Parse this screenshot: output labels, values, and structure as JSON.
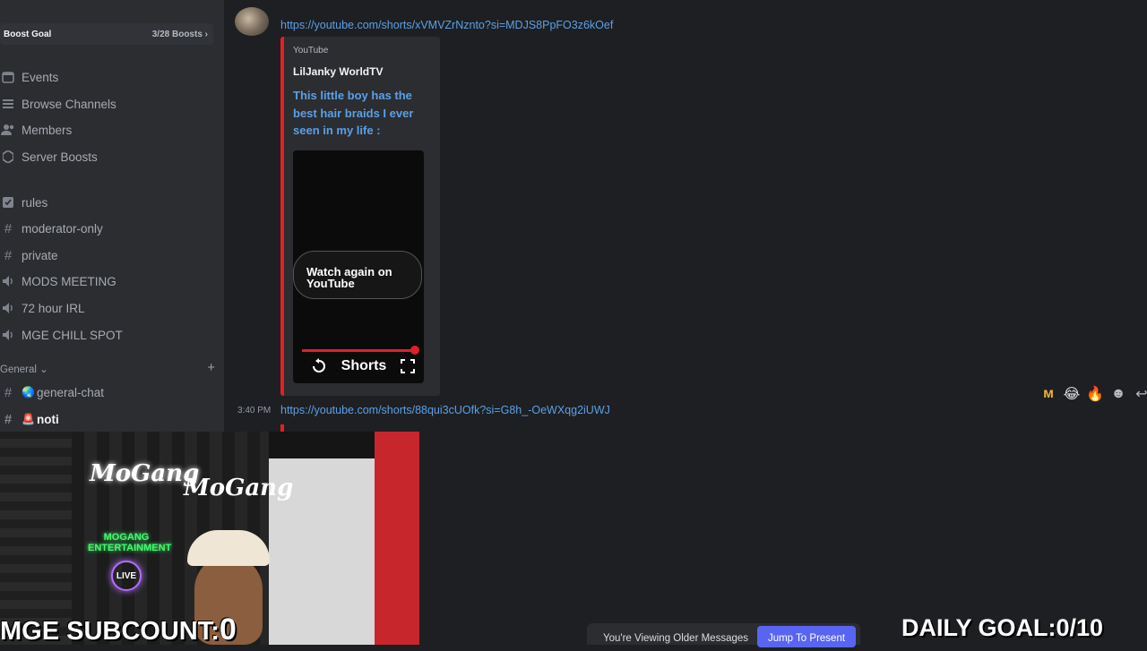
{
  "sidebar": {
    "boost_goal": {
      "label": "Boost Goal",
      "count": "3/28 Boosts"
    },
    "items": [
      {
        "label": "Events",
        "icon": "calendar-icon"
      },
      {
        "label": "Browse Channels",
        "icon": "list-icon"
      },
      {
        "label": "Members",
        "icon": "members-icon"
      },
      {
        "label": "Server Boosts",
        "icon": "boost-icon"
      },
      {
        "label": "rules",
        "icon": "rules-icon"
      },
      {
        "label": "moderator-only",
        "icon": "hash-icon"
      },
      {
        "label": "private",
        "icon": "hash-icon"
      },
      {
        "label": "MODS MEETING",
        "icon": "speaker-icon"
      },
      {
        "label": "72 hour IRL",
        "icon": "speaker-icon"
      },
      {
        "label": "MGE CHILL SPOT",
        "icon": "speaker-icon"
      }
    ],
    "category": {
      "label": "General",
      "add": "+"
    },
    "channels": [
      {
        "label": "general-chat",
        "emoji": "🌏"
      },
      {
        "label": "noti",
        "emoji": "🚨"
      }
    ]
  },
  "messages": [
    {
      "link": "https://youtube.com/shorts/xVMVZrNznto?si=MDJS8PpFO3z6kOef",
      "embed": {
        "provider": "YouTube",
        "author": "LilJanky WorldTV",
        "title": "This little boy has the best hair braids I ever seen in my life :",
        "watch_again": "Watch again on YouTube",
        "shorts_label": "Shorts"
      }
    },
    {
      "time": "3:40 PM",
      "link": "https://youtube.com/shorts/88qui3cUOfk?si=G8h_-OeWXqg2iUWJ"
    }
  ],
  "reactions": [
    "ᴍ",
    "😂",
    "🔥",
    "☻",
    "↩"
  ],
  "overlay": {
    "subcount_label": "MGE SUBCOUNT:",
    "subcount_value": "0",
    "daily_goal": "DAILY GOAL:0/10",
    "cam_text": {
      "logo_a": "MoGang",
      "logo_b": "MoGang",
      "neon": "MOGANG ENTERTAINMENT",
      "live": "LIVE"
    }
  },
  "banner": {
    "label": "You're Viewing Older Messages",
    "jump": "Jump To Present"
  },
  "colors": {
    "accent": "#5865f2",
    "link": "#5aa0e6",
    "youtube_red": "#e21f26"
  }
}
